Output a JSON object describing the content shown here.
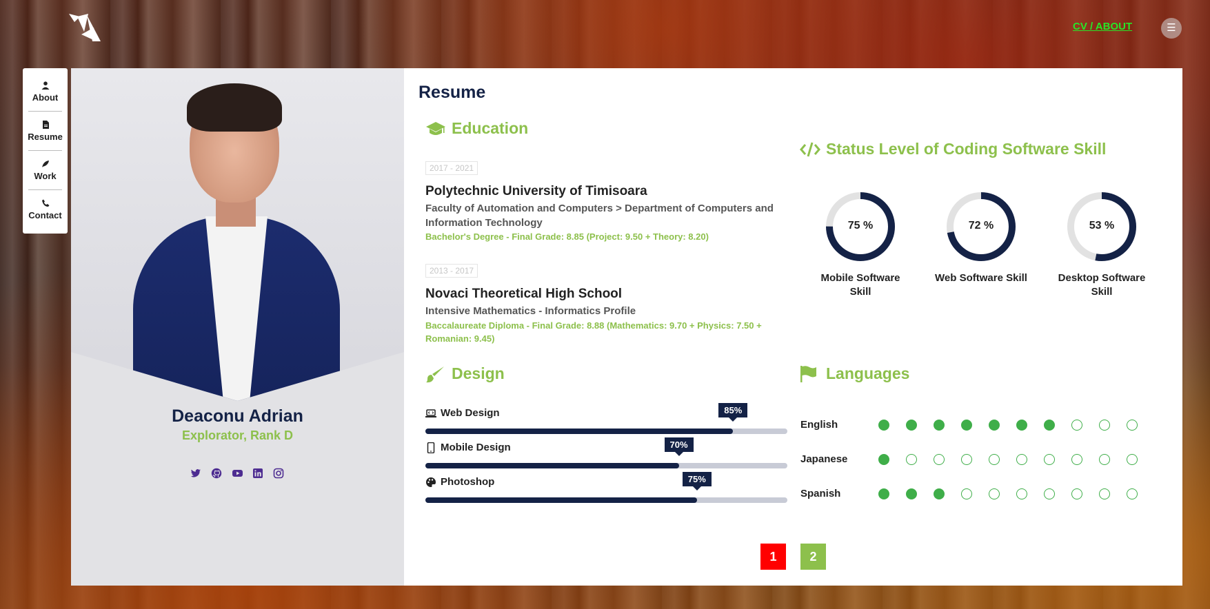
{
  "nav": {
    "top_link": "CV / ABOUT",
    "menu_icon": "hamburger-icon",
    "side_items": [
      {
        "label": "About",
        "icon": "user-icon"
      },
      {
        "label": "Resume",
        "icon": "file-icon"
      },
      {
        "label": "Work",
        "icon": "feather-icon"
      },
      {
        "label": "Contact",
        "icon": "phone-icon"
      }
    ]
  },
  "profile": {
    "name": "Deaconu Adrian",
    "rank": "Explorator, Rank D",
    "socials": [
      "twitter-icon",
      "github-icon",
      "youtube-icon",
      "linkedin-icon",
      "instagram-icon"
    ]
  },
  "resume": {
    "title": "Resume",
    "education": {
      "title": "Education",
      "items": [
        {
          "years": "2017 - 2021",
          "school": "Polytechnic University of Timisoara",
          "faculty": "Faculty of Automation and Computers > Department of Computers and Information Technology",
          "grade": "Bachelor's Degree - Final Grade: 8.85 (Project: 9.50 + Theory: 8.20)"
        },
        {
          "years": "2013 - 2017",
          "school": "Novaci Theoretical High School",
          "faculty": "Intensive Mathematics - Informatics Profile",
          "grade": "Baccalaureate Diploma - Final Grade: 8.88 (Mathematics: 9.70 + Physics: 7.50 + Romanian: 9.45)"
        }
      ]
    },
    "coding": {
      "title": "Status Level of Coding Software Skill",
      "skills": [
        {
          "value": 75,
          "value_text": "75 %",
          "label": "Mobile Software Skill"
        },
        {
          "value": 72,
          "value_text": "72 %",
          "label": "Web Software Skill"
        },
        {
          "value": 53,
          "value_text": "53 %",
          "label": "Desktop Software Skill"
        }
      ]
    },
    "design": {
      "title": "Design",
      "bars": [
        {
          "label": "Web Design",
          "icon": "laptop-code-icon",
          "value": 85,
          "value_text": "85%"
        },
        {
          "label": "Mobile Design",
          "icon": "mobile-icon",
          "value": 70,
          "value_text": "70%"
        },
        {
          "label": "Photoshop",
          "icon": "palette-icon",
          "value": 75,
          "value_text": "75%"
        }
      ]
    },
    "languages": {
      "title": "Languages",
      "max_level": 10,
      "items": [
        {
          "name": "English",
          "level": 7
        },
        {
          "name": "Japanese",
          "level": 1
        },
        {
          "name": "Spanish",
          "level": 3
        }
      ]
    }
  },
  "pagination": {
    "pages": [
      "1",
      "2"
    ],
    "active_color": "#ff0000",
    "other_color": "#8dc04c"
  },
  "colors": {
    "accent_green": "#8dc04c",
    "navy": "#142246",
    "dot_green": "#3fae49"
  }
}
